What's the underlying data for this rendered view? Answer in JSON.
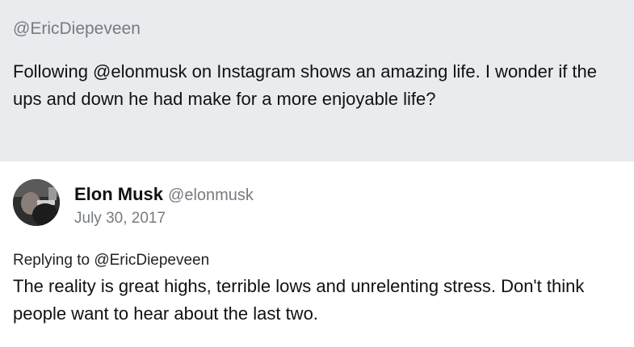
{
  "quoted_tweet": {
    "handle": "@EricDiepeveen",
    "text": "Following @elonmusk on Instagram shows an amazing life. I wonder if the ups and down he had make for a more enjoyable life?"
  },
  "reply_tweet": {
    "author_name": "Elon Musk",
    "author_handle": "@elonmusk",
    "date": "July 30, 2017",
    "replying_to": "Replying to @EricDiepeveen",
    "text": "The reality is great highs, terrible lows and unrelenting stress. Don't think people want to hear about the last two.",
    "avatar_icon": "profile-photo"
  },
  "colors": {
    "quoted_background": "#e9ebee",
    "secondary_text": "#777b80",
    "primary_text": "#111111"
  }
}
